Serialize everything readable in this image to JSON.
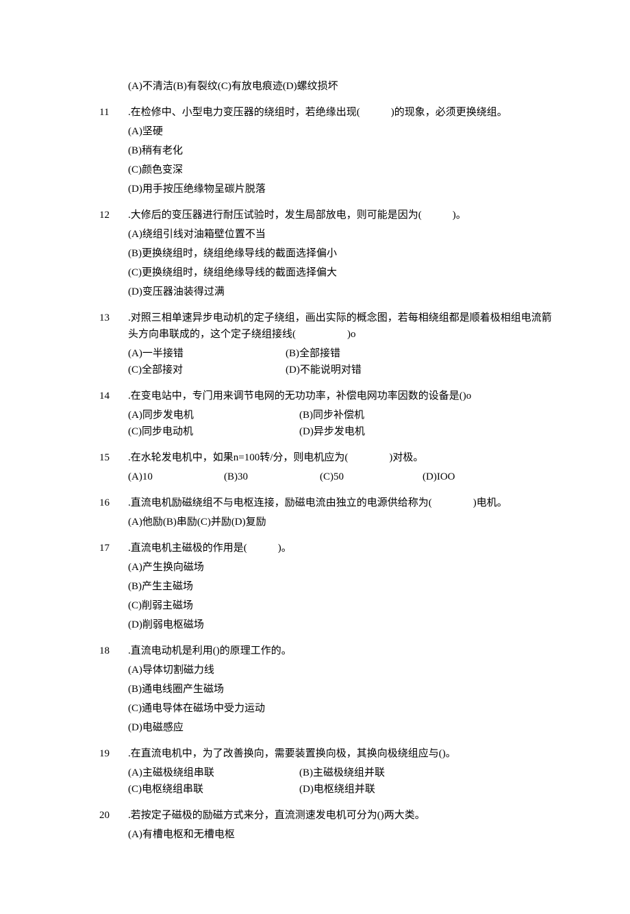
{
  "items": [
    {
      "num": "",
      "stem": "",
      "pre": "(A)不清洁(B)有裂纹(C)有放电痕迹(D)螺纹损坏",
      "opts": []
    },
    {
      "num": "11",
      "stem": ".在检修中、小型电力变压器的绕组时，若绝缘出现(　　　)的现象，必须更换绕组。",
      "opts": [
        {
          "layout": "single",
          "text": "(A)坚硬"
        },
        {
          "layout": "single",
          "text": "(B)稍有老化"
        },
        {
          "layout": "single",
          "text": "(C)颜色变深"
        },
        {
          "layout": "single",
          "text": "(D)用手按压绝缘物呈碳片脱落"
        }
      ]
    },
    {
      "num": "12",
      "stem": ".大修后的变压器进行耐压试验时，发生局部放电，则可能是因为(　　　)。",
      "opts": [
        {
          "layout": "single",
          "text": "(A)绕组引线对油箱壁位置不当"
        },
        {
          "layout": "single",
          "text": "(B)更换绕组时，绕组绝缘导线的截面选择偏小"
        },
        {
          "layout": "single",
          "text": "(C)更换绕组时，绕组绝缘导线的截面选择偏大"
        },
        {
          "layout": "single",
          "text": "(D)变压器油装得过满"
        }
      ]
    },
    {
      "num": "13",
      "stem": ".对照三相单速异步电动机的定子绕组，画出实际的概念图，若每相绕组都是顺着极相组电流箭",
      "stem2": "头方向串联成的，这个定子绕组接线(　　　　　)o",
      "opts": [
        {
          "layout": "row2",
          "a": "(A)一半接错",
          "b": "(B)全部接错"
        },
        {
          "layout": "row2",
          "a": "(C)全部接对",
          "b": "(D)不能说明对错"
        }
      ]
    },
    {
      "num": "14",
      "stem": ".在变电站中，专门用来调节电网的无功功率，补偿电网功率因数的设备是()o",
      "opts": [
        {
          "layout": "row2b",
          "a": "(A)同步发电机",
          "b": "(B)同步补偿机"
        },
        {
          "layout": "row2b",
          "a": "(C)同步电动机",
          "b": "(D)异步发电机"
        }
      ]
    },
    {
      "num": "15",
      "stem": ".在水轮发电机中，如果n=100转/分，则电机应为(　　　　)对极。",
      "opts": [
        {
          "layout": "row4",
          "a": "(A)10",
          "b": "(B)30",
          "c": "(C)50",
          "d": "(D)IOO"
        }
      ]
    },
    {
      "num": "16",
      "stem": ".直流电机励磁绕组不与电枢连接，励磁电流由独立的电源供给称为(　　　　)电机。",
      "opts": [
        {
          "layout": "inlineTight",
          "text": "(A)他励(B)串励(C)并励(D)复励"
        }
      ]
    },
    {
      "num": "17",
      "stem": ".直流电机主磁极的作用是(　　　)。",
      "opts": [
        {
          "layout": "single",
          "text": "(A)产生换向磁场"
        },
        {
          "layout": "single",
          "text": "(B)产生主磁场"
        },
        {
          "layout": "single",
          "text": "(C)削弱主磁场"
        },
        {
          "layout": "single",
          "text": "(D)削弱电枢磁场"
        }
      ]
    },
    {
      "num": "18",
      "stem": ".直流电动机是利用()的原理工作的。",
      "opts": [
        {
          "layout": "single",
          "text": "(A)导体切割磁力线"
        },
        {
          "layout": "single",
          "text": "(B)通电线圈产生磁场"
        },
        {
          "layout": "single",
          "text": "(C)通电导体在磁场中受力运动"
        },
        {
          "layout": "single",
          "text": "(D)电磁感应"
        }
      ]
    },
    {
      "num": "19",
      "stem": ".在直流电机中，为了改善换向，需要装置换向极，其换向极绕组应与()。",
      "opts": [
        {
          "layout": "row2b",
          "a": "(A)主磁极绕组串联",
          "b": "(B)主磁极绕组并联"
        },
        {
          "layout": "row2b",
          "a": "(C)电枢绕组串联",
          "b": "(D)电枢绕组并联"
        }
      ]
    },
    {
      "num": "20",
      "stem": ".若按定子磁极的励磁方式来分，直流测速发电机可分为()两大类。",
      "opts": [
        {
          "layout": "single",
          "text": "(A)有槽电枢和无槽电枢"
        }
      ]
    }
  ]
}
